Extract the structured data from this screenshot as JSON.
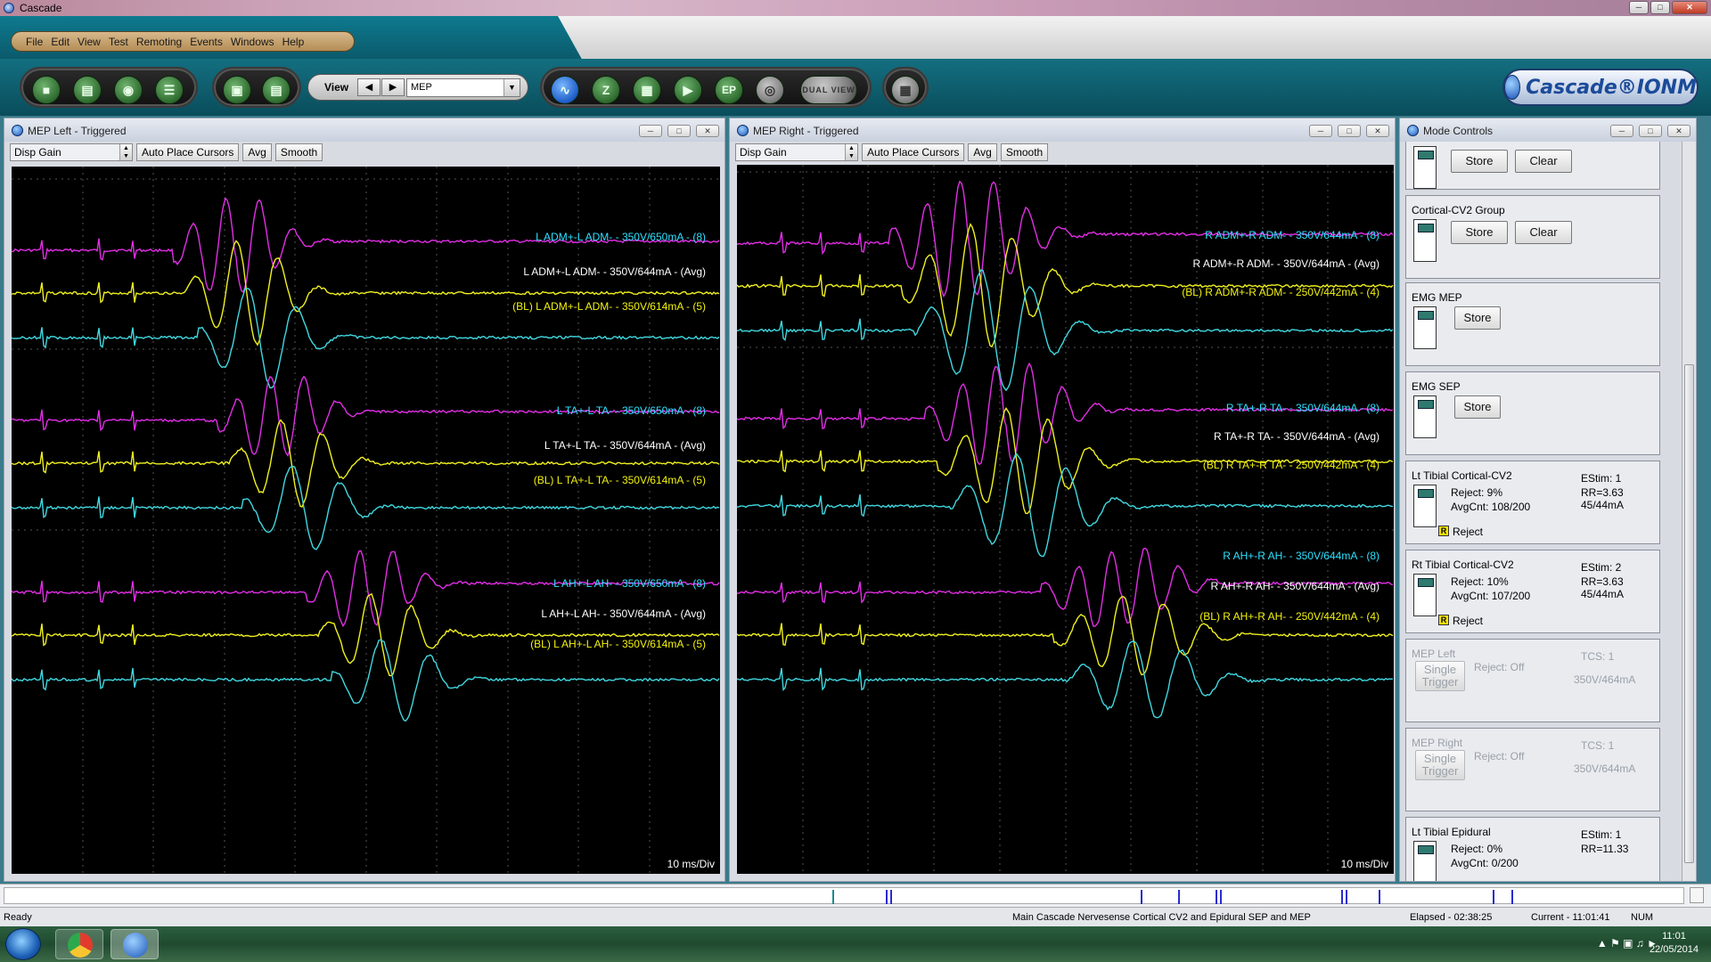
{
  "window": {
    "title": "Cascade"
  },
  "menu": [
    "File",
    "Edit",
    "View",
    "Test",
    "Remoting",
    "Events",
    "Windows",
    "Help"
  ],
  "toolbar": {
    "view_label": "View",
    "view_value": "MEP",
    "ep_label": "EP",
    "dual_view_label": "DUAL VIEW",
    "z_label": "Z",
    "logo_text": "Cascade®IONM"
  },
  "panels": {
    "left": {
      "title": "MEP Left - Triggered",
      "disp_gain": "Disp Gain",
      "auto_place": "Auto Place Cursors",
      "avg": "Avg",
      "smooth": "Smooth",
      "time_div": "10 ms/Div",
      "traces": [
        {
          "label": "L ADM+-L ADM- - 350V/650mA - (8)",
          "color": "#2de0ff"
        },
        {
          "label": "L ADM+-L ADM- - 350V/644mA - (Avg)",
          "color": "#ffffff"
        },
        {
          "label": "(BL) L ADM+-L ADM- - 350V/614mA - (5)",
          "color": "#f2f20f"
        },
        {
          "label": "L TA+-L TA- - 350V/650mA - (8)",
          "color": "#2de0ff"
        },
        {
          "label": "L TA+-L TA- - 350V/644mA - (Avg)",
          "color": "#ffffff"
        },
        {
          "label": "(BL) L TA+-L TA- - 350V/614mA - (5)",
          "color": "#f2f20f"
        },
        {
          "label": "L AH+-L AH- - 350V/650mA - (8)",
          "color": "#2de0ff"
        },
        {
          "label": "L AH+-L AH- - 350V/644mA - (Avg)",
          "color": "#ffffff"
        },
        {
          "label": "(BL) L AH+-L AH- - 350V/614mA - (5)",
          "color": "#f2f20f"
        }
      ]
    },
    "right": {
      "title": "MEP Right - Triggered",
      "disp_gain": "Disp Gain",
      "auto_place": "Auto Place Cursors",
      "avg": "Avg",
      "smooth": "Smooth",
      "time_div": "10 ms/Div",
      "traces": [
        {
          "label": "R ADM+-R ADM- - 350V/644mA - (8)",
          "color": "#2de0ff"
        },
        {
          "label": "R ADM+-R ADM- - 350V/644mA - (Avg)",
          "color": "#ffffff"
        },
        {
          "label": "(BL) R ADM+-R ADM- - 250V/442mA - (4)",
          "color": "#f2f20f"
        },
        {
          "label": "R TA+-R TA- - 350V/644mA - (8)",
          "color": "#2de0ff"
        },
        {
          "label": "R TA+-R TA- - 350V/644mA - (Avg)",
          "color": "#ffffff"
        },
        {
          "label": "(BL) R TA+-R TA- - 250V/442mA - (4)",
          "color": "#f2f20f"
        },
        {
          "label": "R AH+-R AH- - 350V/644mA - (8)",
          "color": "#2de0ff"
        },
        {
          "label": "R AH+-R AH- - 350V/644mA - (Avg)",
          "color": "#ffffff"
        },
        {
          "label": "(BL) R AH+-R AH- - 250V/442mA - (4)",
          "color": "#f2f20f"
        }
      ]
    }
  },
  "mode_controls": {
    "title": "Mode Controls",
    "cards": [
      {
        "title": "",
        "store": "Store",
        "clear": "Clear"
      },
      {
        "title": "Cortical-CV2 Group",
        "store": "Store",
        "clear": "Clear"
      },
      {
        "title": "EMG MEP",
        "store": "Store"
      },
      {
        "title": "EMG SEP",
        "store": "Store"
      },
      {
        "title": "Lt Tibial Cortical-CV2",
        "reject": "Reject:  9%",
        "avgcnt": "AvgCnt:  108/200",
        "estim": "EStim: 1",
        "rr": "RR=3.63",
        "ma": "45/44mA",
        "reject_flag": "Reject"
      },
      {
        "title": "Rt Tibial Cortical-CV2",
        "reject": "Reject:  10%",
        "avgcnt": "AvgCnt:  107/200",
        "estim": "EStim: 2",
        "rr": "RR=3.63",
        "ma": "45/44mA",
        "reject_flag": "Reject"
      },
      {
        "title": "MEP Left",
        "trigger": "Single Trigger",
        "reject": "Reject:   Off",
        "tcs": "TCS: 1",
        "va": "350V/464mA"
      },
      {
        "title": "MEP Right",
        "trigger": "Single Trigger",
        "reject": "Reject:   Off",
        "tcs": "TCS: 1",
        "va": "350V/644mA"
      },
      {
        "title": "Lt Tibial Epidural",
        "reject": "Reject:  0%",
        "avgcnt": "AvgCnt:  0/200",
        "estim": "EStim: 1",
        "rr": "RR=11.33"
      }
    ]
  },
  "status": {
    "ready": "Ready",
    "procedure": "Main Cascade Nervesense Cortical CV2 and Epidural SEP and MEP",
    "elapsed": "Elapsed - 02:38:25",
    "current": "Current - 11:01:41",
    "num": "NUM"
  },
  "taskbar": {
    "time": "11:01",
    "date": "22/05/2014"
  }
}
